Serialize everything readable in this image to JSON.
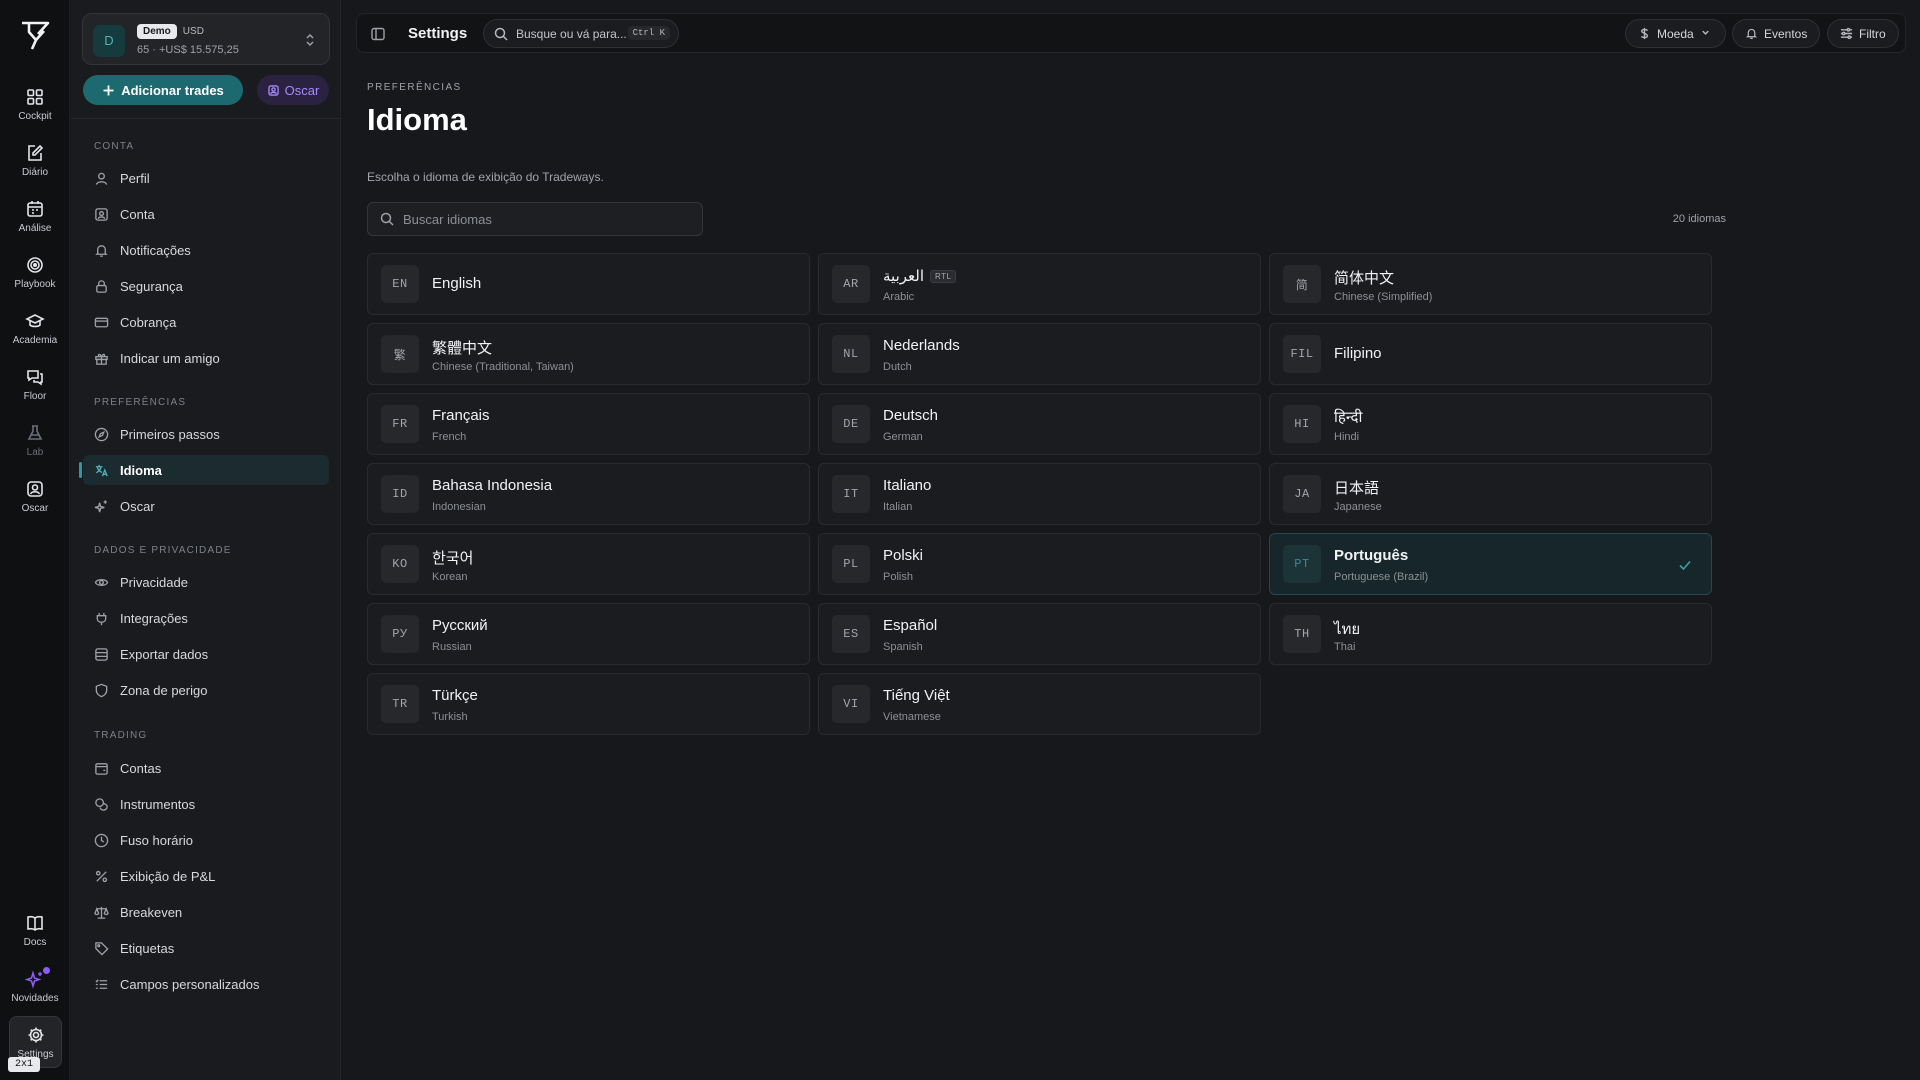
{
  "rail": {
    "items": [
      {
        "label": "Cockpit",
        "icon": "grid-icon"
      },
      {
        "label": "Diário",
        "icon": "journal-icon"
      },
      {
        "label": "Análise",
        "icon": "calendar-icon"
      },
      {
        "label": "Playbook",
        "icon": "target-icon"
      },
      {
        "label": "Academia",
        "icon": "graduation-cap-icon"
      },
      {
        "label": "Floor",
        "icon": "chat-icon"
      },
      {
        "label": "Lab",
        "icon": "flask-icon"
      },
      {
        "label": "Oscar",
        "icon": "oscar-icon"
      }
    ],
    "bottom": [
      {
        "label": "Docs",
        "icon": "book-icon"
      },
      {
        "label": "Novidades",
        "icon": "sparkle-icon"
      },
      {
        "label": "Settings",
        "icon": "gear-icon"
      }
    ],
    "zoom_badge": "2x1"
  },
  "account": {
    "avatar": "D",
    "badge": "Demo",
    "currency": "USD",
    "summary": "65 · +US$ 15.575,25"
  },
  "actions": {
    "add_trades": "Adicionar trades",
    "oscar": "Oscar"
  },
  "sidebar": {
    "sections": [
      {
        "title": "CONTA",
        "items": [
          "Perfil",
          "Conta",
          "Notificações",
          "Segurança",
          "Cobrança",
          "Indicar um amigo"
        ]
      },
      {
        "title": "PREFERÊNCIAS",
        "items": [
          "Primeiros passos",
          "Idioma",
          "Oscar"
        ]
      },
      {
        "title": "DADOS E PRIVACIDADE",
        "items": [
          "Privacidade",
          "Integrações",
          "Exportar dados",
          "Zona de perigo"
        ]
      },
      {
        "title": "TRADING",
        "items": [
          "Contas",
          "Instrumentos",
          "Fuso horário",
          "Exibição de P&L",
          "Breakeven",
          "Etiquetas",
          "Campos personalizados"
        ]
      }
    ],
    "active": "Idioma"
  },
  "topbar": {
    "title": "Settings",
    "search_placeholder": "Busque ou vá para...",
    "search_shortcut": "Ctrl K",
    "currency_btn": "Moeda",
    "events_btn": "Eventos",
    "filter_btn": "Filtro"
  },
  "page": {
    "eyebrow": "PREFERÊNCIAS",
    "title": "Idioma",
    "description": "Escolha o idioma de exibição do Tradeways.",
    "search_placeholder": "Buscar idiomas",
    "count": "20 idiomas"
  },
  "languages": [
    {
      "code": "EN",
      "native": "English",
      "english": "",
      "rtl": false
    },
    {
      "code": "AR",
      "native": "العربية",
      "english": "Arabic",
      "rtl": true
    },
    {
      "code": "简",
      "native": "简体中文",
      "english": "Chinese (Simplified)",
      "rtl": false
    },
    {
      "code": "繁",
      "native": "繁體中文",
      "english": "Chinese (Traditional, Taiwan)",
      "rtl": false
    },
    {
      "code": "NL",
      "native": "Nederlands",
      "english": "Dutch",
      "rtl": false
    },
    {
      "code": "FIL",
      "native": "Filipino",
      "english": "",
      "rtl": false
    },
    {
      "code": "FR",
      "native": "Français",
      "english": "French",
      "rtl": false
    },
    {
      "code": "DE",
      "native": "Deutsch",
      "english": "German",
      "rtl": false
    },
    {
      "code": "HI",
      "native": "हिन्दी",
      "english": "Hindi",
      "rtl": false
    },
    {
      "code": "ID",
      "native": "Bahasa Indonesia",
      "english": "Indonesian",
      "rtl": false
    },
    {
      "code": "IT",
      "native": "Italiano",
      "english": "Italian",
      "rtl": false
    },
    {
      "code": "JA",
      "native": "日本語",
      "english": "Japanese",
      "rtl": false
    },
    {
      "code": "KO",
      "native": "한국어",
      "english": "Korean",
      "rtl": false
    },
    {
      "code": "PL",
      "native": "Polski",
      "english": "Polish",
      "rtl": false
    },
    {
      "code": "PT",
      "native": "Português",
      "english": "Portuguese (Brazil)",
      "rtl": false,
      "selected": true
    },
    {
      "code": "РУ",
      "native": "Русский",
      "english": "Russian",
      "rtl": false
    },
    {
      "code": "ES",
      "native": "Español",
      "english": "Spanish",
      "rtl": false
    },
    {
      "code": "TH",
      "native": "ไทย",
      "english": "Thai",
      "rtl": false
    },
    {
      "code": "TR",
      "native": "Türkçe",
      "english": "Turkish",
      "rtl": false
    },
    {
      "code": "VI",
      "native": "Tiếng Việt",
      "english": "Vietnamese",
      "rtl": false
    }
  ],
  "colors": {
    "accent": "#1d6970",
    "accent_light": "#3aa2aa",
    "oscar": "#a78bfa",
    "background": "#17181b"
  }
}
